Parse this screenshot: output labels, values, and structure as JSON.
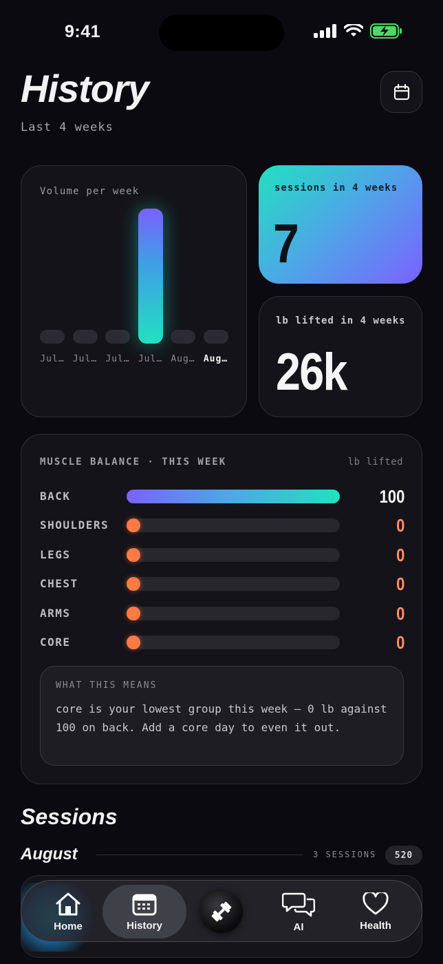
{
  "status": {
    "time": "9:41"
  },
  "header": {
    "title": "History",
    "subtitle": "Last 4 weeks"
  },
  "volume": {
    "label": "Volume per week",
    "chart_data": {
      "type": "bar",
      "categories": [
        "Jul…",
        "Jul…",
        "Jul…",
        "Jul…",
        "Aug…",
        "Aug…"
      ],
      "values": [
        0,
        0,
        3,
        100,
        0,
        0
      ],
      "highlight_index": 3,
      "current_index": 5,
      "title": "Volume per week"
    }
  },
  "stats": {
    "sessions_label": "sessions in 4 weeks",
    "sessions_value": "7",
    "lifted_label": "lb lifted in 4 weeks",
    "lifted_value": "26k"
  },
  "muscle_balance": {
    "title": "MUSCLE BALANCE · THIS WEEK",
    "unit": "lb lifted",
    "rows": [
      {
        "name": "BACK",
        "value": "100",
        "fraction": 1.0
      },
      {
        "name": "SHOULDERS",
        "value": "0",
        "fraction": 0
      },
      {
        "name": "LEGS",
        "value": "0",
        "fraction": 0
      },
      {
        "name": "CHEST",
        "value": "0",
        "fraction": 0
      },
      {
        "name": "ARMS",
        "value": "0",
        "fraction": 0
      },
      {
        "name": "CORE",
        "value": "0",
        "fraction": 0
      }
    ],
    "means_heading": "WHAT THIS MEANS",
    "means_body": "core is your lowest group this week — 0 lb against 100 on back. Add a core day to even it out."
  },
  "sessions": {
    "heading": "Sessions",
    "month": "August",
    "month_count": "3 SESSIONS",
    "month_badge": "520"
  },
  "tabs": [
    {
      "label": "Home",
      "icon": "home-icon"
    },
    {
      "label": "History",
      "icon": "calendar-icon"
    },
    {
      "label": "",
      "icon": "dumbbell-icon"
    },
    {
      "label": "AI",
      "icon": "chat-bubbles-icon"
    },
    {
      "label": "Health",
      "icon": "heart-icon"
    }
  ],
  "colors": {
    "accent_gradient_start": "#22e0c0",
    "accent_gradient_end": "#7b61ff",
    "warning": "#ff7a45"
  }
}
